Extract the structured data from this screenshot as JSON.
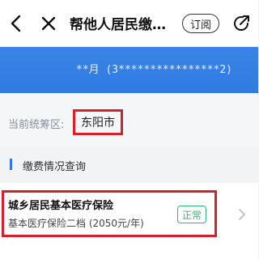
{
  "header": {
    "title": "帮他人居民缴…",
    "subscribe_label": "订阅",
    "back_icon": "chevron-left-icon",
    "close_icon": "close-icon",
    "share_icon": "share-icon"
  },
  "banner": {
    "info_text": "**月 (3****************2)"
  },
  "region": {
    "label": "当前统筹区:",
    "value": "东阳市"
  },
  "section": {
    "title": "缴费情况查询"
  },
  "insurance_card": {
    "name": "城乡居民基本医疗保险",
    "detail": "基本医疗保险二档 (2050元/年)",
    "status": "正常"
  },
  "colors": {
    "accent_blue": "#2f7be3",
    "highlight_red": "#d6202a",
    "status_green": "#2eb872"
  }
}
